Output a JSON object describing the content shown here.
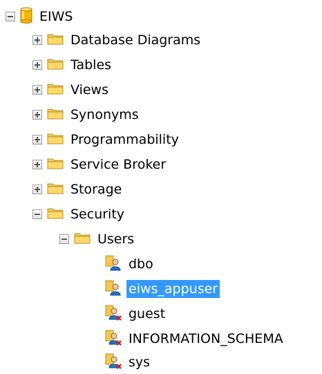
{
  "tree": {
    "root": {
      "label": "EIWS",
      "icon": "database-icon",
      "expanded": true
    },
    "folders": [
      {
        "label": "Database Diagrams",
        "icon": "folder-icon",
        "expanded": false
      },
      {
        "label": "Tables",
        "icon": "folder-icon",
        "expanded": false
      },
      {
        "label": "Views",
        "icon": "folder-icon",
        "expanded": false
      },
      {
        "label": "Synonyms",
        "icon": "folder-icon",
        "expanded": false
      },
      {
        "label": "Programmability",
        "icon": "folder-icon",
        "expanded": false
      },
      {
        "label": "Service Broker",
        "icon": "folder-icon",
        "expanded": false
      },
      {
        "label": "Storage",
        "icon": "folder-icon",
        "expanded": false
      },
      {
        "label": "Security",
        "icon": "folder-icon",
        "expanded": true
      }
    ],
    "users_folder": {
      "label": "Users",
      "icon": "folder-icon",
      "expanded": true
    },
    "users": [
      {
        "label": "dbo",
        "icon": "user-icon",
        "selected": false
      },
      {
        "label": "eiws_appuser",
        "icon": "user-icon",
        "selected": true
      },
      {
        "label": "guest",
        "icon": "user-disabled-icon",
        "selected": false
      },
      {
        "label": "INFORMATION_SCHEMA",
        "icon": "user-disabled-icon",
        "selected": false
      },
      {
        "label": "sys",
        "icon": "user-disabled-icon",
        "selected": false
      }
    ]
  },
  "colors": {
    "selection": "#3399ff",
    "folder": "#f2c94c",
    "database": "#f5b800",
    "user": "#1d73c9"
  }
}
